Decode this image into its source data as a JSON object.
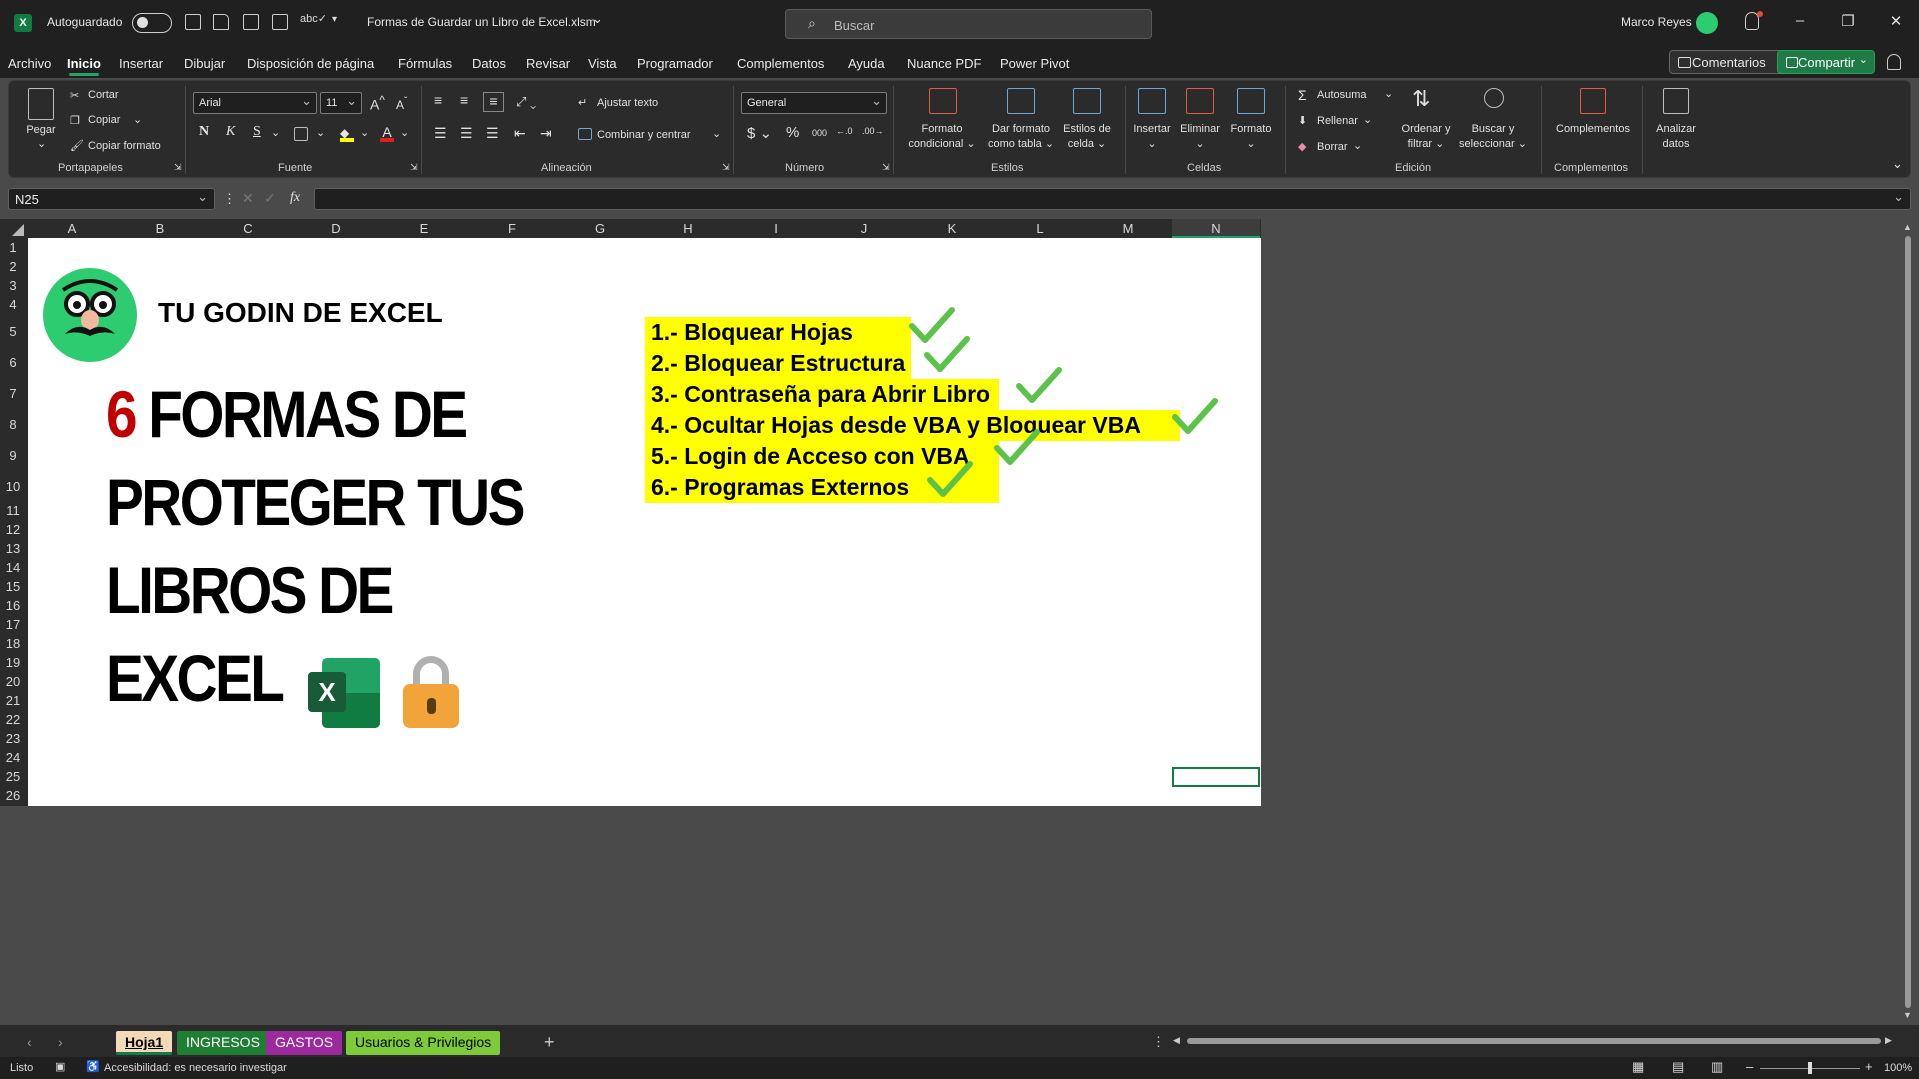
{
  "titlebar": {
    "autosave_label": "Autoguardado",
    "document_title": "Formas de Guardar un Libro de Excel.xlsm",
    "search_placeholder": "Buscar",
    "user_name": "Marco Reyes"
  },
  "menu": {
    "items": [
      "Archivo",
      "Inicio",
      "Insertar",
      "Dibujar",
      "Disposición de página",
      "Fórmulas",
      "Datos",
      "Revisar",
      "Vista",
      "Programador",
      "Complementos",
      "Ayuda",
      "Nuance PDF",
      "Power Pivot"
    ],
    "active": "Inicio",
    "comments_label": "Comentarios",
    "share_label": "Compartir"
  },
  "ribbon": {
    "clipboard": {
      "paste": "Pegar",
      "cut": "Cortar",
      "copy": "Copiar",
      "format_painter": "Copiar formato",
      "group": "Portapapeles"
    },
    "font": {
      "name": "Arial",
      "size": "11",
      "group": "Fuente"
    },
    "alignment": {
      "wrap": "Ajustar texto",
      "merge": "Combinar y centrar",
      "group": "Alineación"
    },
    "number": {
      "format": "General",
      "group": "Número"
    },
    "styles": {
      "conditional_1": "Formato",
      "conditional_2": "condicional",
      "table_1": "Dar formato",
      "table_2": "como tabla",
      "cell_1": "Estilos de",
      "cell_2": "celda",
      "group": "Estilos"
    },
    "cells": {
      "insert": "Insertar",
      "delete": "Eliminar",
      "format": "Formato",
      "group": "Celdas"
    },
    "editing": {
      "autosum": "Autosuma",
      "fill": "Rellenar",
      "clear": "Borrar",
      "sort_1": "Ordenar y",
      "sort_2": "filtrar",
      "find_1": "Buscar y",
      "find_2": "seleccionar",
      "group": "Edición"
    },
    "addins": {
      "label": "Complementos",
      "group": "Complementos"
    },
    "analyze": {
      "label_1": "Analizar",
      "label_2": "datos"
    }
  },
  "formula_bar": {
    "name_box": "N25",
    "fx": "fx",
    "formula": ""
  },
  "grid": {
    "columns": [
      "A",
      "B",
      "C",
      "D",
      "E",
      "F",
      "G",
      "H",
      "I",
      "J",
      "K",
      "L",
      "M",
      "N"
    ],
    "selected_column": "N",
    "rows": [
      "1",
      "2",
      "3",
      "4",
      "5",
      "6",
      "7",
      "8",
      "9",
      "10",
      "11",
      "12",
      "13",
      "14",
      "15",
      "16",
      "17",
      "18",
      "19",
      "20",
      "21",
      "22",
      "23",
      "24",
      "25",
      "26"
    ]
  },
  "content": {
    "brand": "TU GODIN DE EXCEL",
    "title_number": "6",
    "title_line1": "FORMAS DE",
    "title_line2": "PROTEGER TUS",
    "title_line3": "LIBROS DE",
    "title_line4": "EXCEL",
    "list": [
      "1.- Bloquear Hojas",
      "2.- Bloquear Estructura",
      "3.- Contraseña para Abrir Libro",
      "4.- Ocultar Hojas desde VBA y Bloquear VBA",
      "5.- Login de Acceso con VBA",
      "6.- Programas Externos"
    ]
  },
  "sheets": [
    {
      "name": "Hoja1",
      "color": "#f3d9b8",
      "text_color": "#000000",
      "active": true
    },
    {
      "name": "INGRESOS",
      "color": "#1e7e34",
      "text_color": "#ffffff",
      "active": false
    },
    {
      "name": "GASTOS",
      "color": "#9c2a9c",
      "text_color": "#ffffff",
      "active": false
    },
    {
      "name": "Usuarios & Privilegios",
      "color": "#7ecb3a",
      "text_color": "#000000",
      "active": false
    }
  ],
  "statusbar": {
    "ready": "Listo",
    "accessibility": "Accesibilidad: es necesario investigar",
    "zoom": "100%"
  },
  "colors": {
    "accent_green": "#107c41",
    "highlight_yellow": "#ffff00",
    "title_red": "#c00000"
  }
}
